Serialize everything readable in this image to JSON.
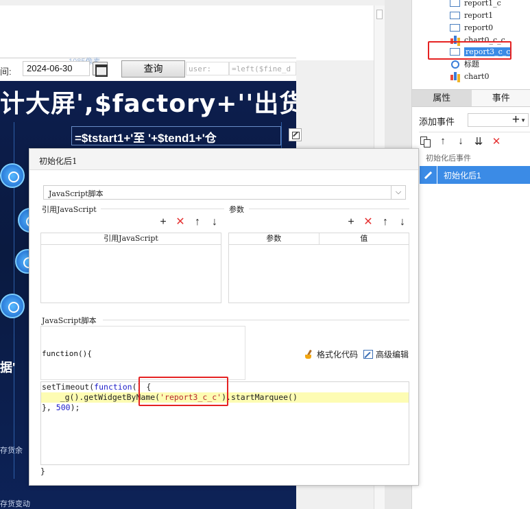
{
  "canvas": {
    "date_label": "间:",
    "date_value": "2024-06-30",
    "query_label": "查询",
    "watermark": "1085像素",
    "user_field": "user:",
    "fine_field": "=left($fine_d",
    "report_title": "计大屏',$factory+''出货",
    "report_subtitle": "=$tstart1+'至 '+$tend1+'仓",
    "side_texts": [
      "据'"
    ],
    "left_bottom_texts": [
      "存货余",
      "存货变动"
    ]
  },
  "tree": {
    "items": [
      {
        "label": "report1_c",
        "icon": "report"
      },
      {
        "label": "report1",
        "icon": "report"
      },
      {
        "label": "report0",
        "icon": "report"
      },
      {
        "label": "chart0_c_c",
        "icon": "chart"
      },
      {
        "label": "report3_c_c",
        "icon": "report",
        "selected": true
      },
      {
        "label": "标题",
        "icon": "title"
      },
      {
        "label": "chart0",
        "icon": "chart"
      }
    ]
  },
  "panel": {
    "tabs": [
      "属性",
      "事件"
    ],
    "add_event_label": "添加事件",
    "add_event_plus": "+",
    "event_section_label": "初始化后事件",
    "event_item_label": "初始化后1"
  },
  "dialog": {
    "title": "初始化后1",
    "script_type": "JavaScript脚本",
    "ref_js_label": "引用JavaScript",
    "params_label": "参数",
    "ref_js_column": "引用JavaScript",
    "param_columns": [
      "参数",
      "值"
    ],
    "js_script_label": "JavaScript脚本",
    "function_header": "function(){",
    "format_code_label": "格式化代码",
    "advanced_edit_label": "高级编辑",
    "code_lines": {
      "line1_a": "setTimeout(",
      "line1_kw": "function",
      "line1_b": "() {",
      "line2_a": "    _g().getWidgetByName(",
      "line2_str": "'report3_c_c'",
      "line2_b": ").startMarquee()",
      "line3_a": "}, ",
      "line3_num": "500",
      "line3_b": ");"
    },
    "closing_brace": "}"
  },
  "colors": {
    "selection_blue": "#3b8be6",
    "highlight_red": "#e52222",
    "editor_highlight": "#fdfcb3"
  }
}
